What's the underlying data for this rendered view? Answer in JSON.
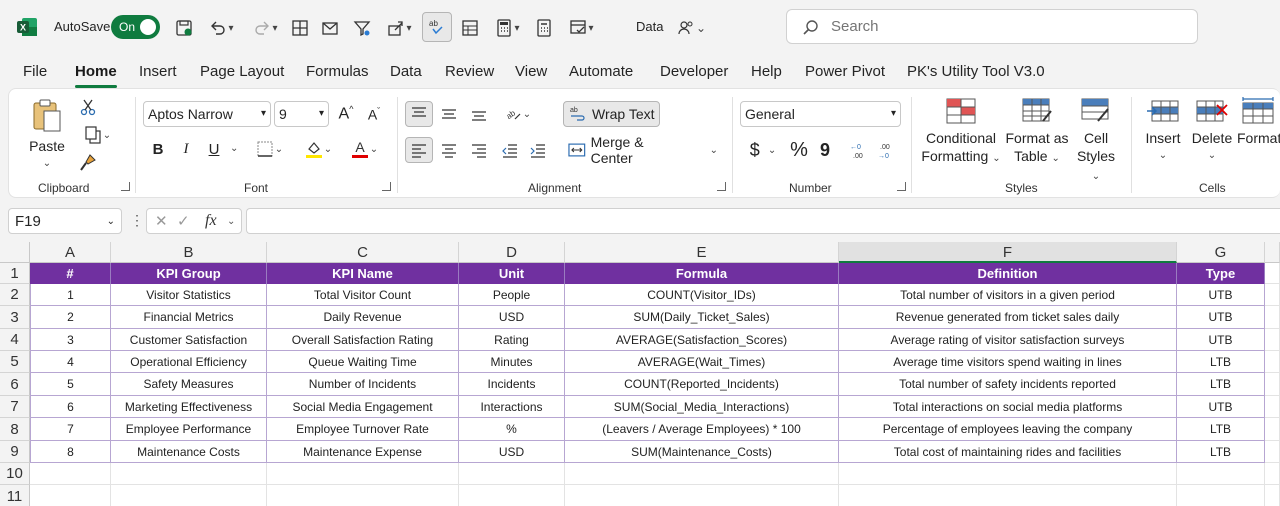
{
  "titlebar": {
    "autosave_label": "AutoSave",
    "autosave_state": "On",
    "doc_title": "Data",
    "search_placeholder": "Search"
  },
  "tabs": [
    "File",
    "Home",
    "Insert",
    "Page Layout",
    "Formulas",
    "Data",
    "Review",
    "View",
    "Automate",
    "Developer",
    "Help",
    "Power Pivot",
    "PK's Utility Tool V3.0"
  ],
  "active_tab": "Home",
  "ribbon": {
    "clipboard": {
      "label": "Clipboard",
      "paste": "Paste"
    },
    "font": {
      "label": "Font",
      "family": "Aptos Narrow",
      "size": "9",
      "bold": "B",
      "italic": "I",
      "underline": "U"
    },
    "alignment": {
      "label": "Alignment",
      "wrap_text": "Wrap Text",
      "merge_center": "Merge & Center"
    },
    "number": {
      "label": "Number",
      "format": "General",
      "currency": "$",
      "percent": "%",
      "comma": "9"
    },
    "styles": {
      "label": "Styles",
      "conditional_1": "Conditional",
      "conditional_2": "Formatting",
      "format_table_1": "Format as",
      "format_table_2": "Table",
      "cell_styles_1": "Cell",
      "cell_styles_2": "Styles"
    },
    "cells": {
      "label": "Cells",
      "insert": "Insert",
      "delete": "Delete",
      "format": "Format"
    }
  },
  "formula_bar": {
    "name_box": "F19",
    "fx": "fx",
    "content": ""
  },
  "grid": {
    "columns": [
      "A",
      "B",
      "C",
      "D",
      "E",
      "F",
      "G"
    ],
    "selected_column": "F",
    "rows": [
      "1",
      "2",
      "3",
      "4",
      "5",
      "6",
      "7",
      "8",
      "9",
      "10",
      "11"
    ],
    "header": [
      "#",
      "KPI Group",
      "KPI Name",
      "Unit",
      "Formula",
      "Definition",
      "Type"
    ],
    "data": [
      [
        "1",
        "Visitor Statistics",
        "Total Visitor Count",
        "People",
        "COUNT(Visitor_IDs)",
        "Total number of visitors in a given period",
        "UTB"
      ],
      [
        "2",
        "Financial Metrics",
        "Daily Revenue",
        "USD",
        "SUM(Daily_Ticket_Sales)",
        "Revenue generated from ticket sales daily",
        "UTB"
      ],
      [
        "3",
        "Customer Satisfaction",
        "Overall Satisfaction Rating",
        "Rating",
        "AVERAGE(Satisfaction_Scores)",
        "Average rating of visitor satisfaction surveys",
        "UTB"
      ],
      [
        "4",
        "Operational Efficiency",
        "Queue Waiting Time",
        "Minutes",
        "AVERAGE(Wait_Times)",
        "Average time visitors spend waiting in lines",
        "LTB"
      ],
      [
        "5",
        "Safety Measures",
        "Number of Incidents",
        "Incidents",
        "COUNT(Reported_Incidents)",
        "Total number of safety incidents reported",
        "LTB"
      ],
      [
        "6",
        "Marketing Effectiveness",
        "Social Media Engagement",
        "Interactions",
        "SUM(Social_Media_Interactions)",
        "Total interactions on social media platforms",
        "UTB"
      ],
      [
        "7",
        "Employee Performance",
        "Employee Turnover Rate",
        "%",
        "(Leavers / Average Employees) * 100",
        "Percentage of employees leaving the company",
        "LTB"
      ],
      [
        "8",
        "Maintenance Costs",
        "Maintenance Expense",
        "USD",
        "SUM(Maintenance_Costs)",
        "Total cost of maintaining rides and facilities",
        "LTB"
      ]
    ],
    "header_color": "#7030a0"
  }
}
